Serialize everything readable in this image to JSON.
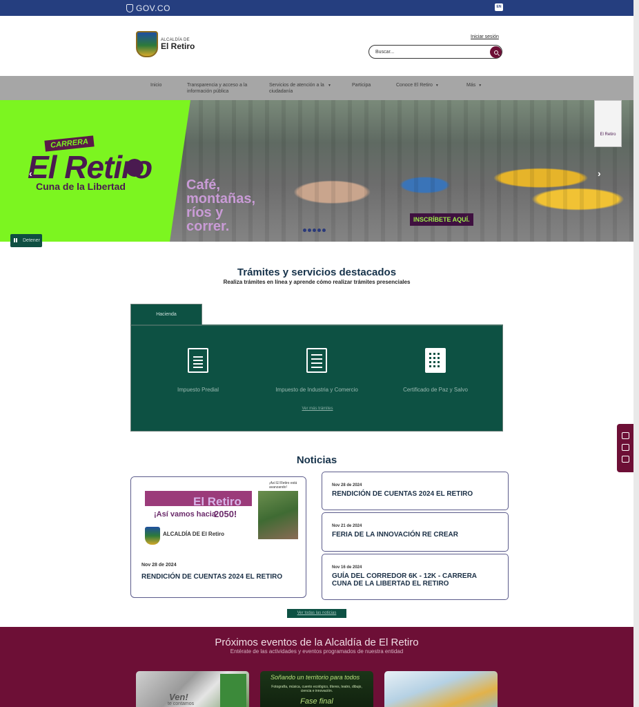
{
  "gov_bar": {
    "brand": "GOV.CO",
    "lang": "EN"
  },
  "header": {
    "logo_line1": "ALCALDÍA DE",
    "logo_line2": "El Retiro",
    "login_label": "Iniciar sesión",
    "search_placeholder": "Buscar..."
  },
  "nav": {
    "items": [
      {
        "label": "Inicio"
      },
      {
        "label": "Transparencia y acceso a la información pública"
      },
      {
        "label": "Servicios de atención a la ciudadanía",
        "caret": "▼"
      },
      {
        "label": "Participa"
      },
      {
        "label": "Conoce El Retiro",
        "caret": "▼"
      },
      {
        "label": "Más",
        "caret": "▼"
      }
    ]
  },
  "hero": {
    "tag": "CARRERA",
    "title": "El Retiro",
    "subtitle": "Cuna de la Libertad",
    "slogan": "Café,\nmontañas,\nríos y\ncorrer.",
    "cta": "INSCRÍBETE AQUÍ.",
    "badge": "El Retiro",
    "prev_arrow": "‹",
    "next_arrow": "›",
    "pause_label": "Detener"
  },
  "tramites": {
    "title": "Trámites y servicios destacados",
    "subtitle": "Realiza trámites en línea y aprende cómo realizar trámites presenciales",
    "tab": "Hacienda",
    "items": [
      {
        "label": "Impuesto Predial",
        "icon": "document-icon"
      },
      {
        "label": "Impuesto de Industria y Comercio",
        "icon": "ledger-icon"
      },
      {
        "label": "Certificado de Paz y Salvo",
        "icon": "building-icon"
      }
    ],
    "more_label": "Ver más trámites"
  },
  "news": {
    "title": "Noticias",
    "featured": {
      "image_band": "Rendición de Cuentas 2024",
      "image_title": "El Retiro",
      "image_subtitle": "¡Así vamos hacia",
      "image_year": "2050!",
      "image_logo": "ALCALDÍA DE El Retiro",
      "image_corner": "¡Así El Retiro está avanzando!",
      "date": "Nov 28 de 2024",
      "title": "RENDICIÓN DE CUENTAS 2024 EL RETIRO"
    },
    "items": [
      {
        "date": "Nov 28 de 2024",
        "title": "RENDICIÓN DE CUENTAS 2024 EL RETIRO"
      },
      {
        "date": "Nov 21 de 2024",
        "title": "FERIA DE LA INNOVACIÓN RE CREAR"
      },
      {
        "date": "Nov 16 de 2024",
        "title": "GUÍA DEL CORREDOR 6K - 12K - CARRERA CUNA DE LA LIBERTAD EL RETIRO"
      }
    ],
    "all_label": "Ver todas las noticias"
  },
  "events": {
    "title": "Próximos eventos de la Alcaldía de El Retiro",
    "subtitle": "Entérate de las actividades y eventos programados de nuestra entidad",
    "cards": [
      {
        "line1": "Ven!",
        "line2": "te contamos"
      },
      {
        "line1": "Soñando un territorio para todos",
        "line2": "Fotografía, música, cuento ecológico, títeres, teatro, dibujo, ciencia e innovación.",
        "line3": "Fase final"
      },
      {
        "line1": ""
      }
    ]
  },
  "colors": {
    "gov_blue": "#253e7f",
    "brand_wine": "#6d0f36",
    "brand_green": "#0d5143",
    "hero_lime": "#7cf520"
  }
}
